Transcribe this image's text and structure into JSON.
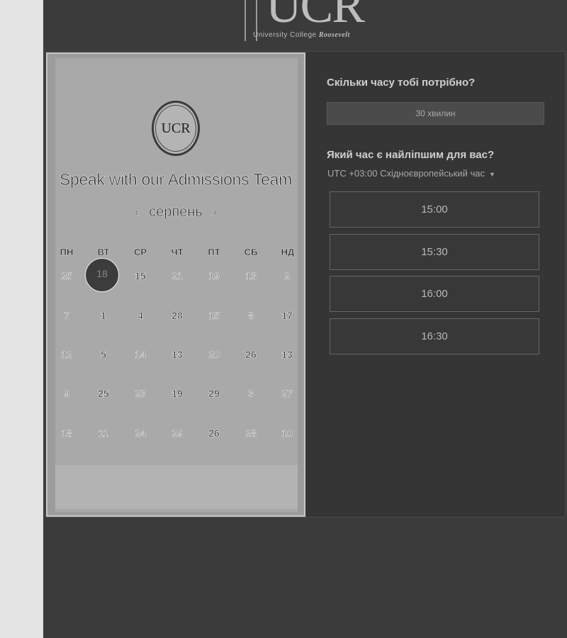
{
  "header": {
    "logo_big": "UCR",
    "logo_sub_normal": "University College ",
    "logo_sub_bold": "Roosevelt"
  },
  "calendar": {
    "emblem_text": "UCR",
    "title": "Speak with our Admissions Team",
    "month": "серпень",
    "prev_icon": "‹",
    "next_icon": "›",
    "weekdays": [
      "ПН",
      "ВТ",
      "СР",
      "ЧТ",
      "ПТ",
      "СБ",
      "НД"
    ],
    "selected_day": "18",
    "weeks": [
      [
        "25",
        "",
        "15",
        "21",
        "19",
        "13",
        "2"
      ],
      [
        "7",
        "1",
        "4",
        "28",
        "15",
        "8",
        "17"
      ],
      [
        "12",
        "5",
        "14",
        "13",
        "20",
        "26",
        "13"
      ],
      [
        "9",
        "25",
        "23",
        "19",
        "29",
        "3",
        "27"
      ],
      [
        "18",
        "11",
        "24",
        "29",
        "26",
        "28",
        "10"
      ]
    ]
  },
  "booking": {
    "duration_question": "Скільки часу тобі потрібно?",
    "duration_value": "30 хвилин",
    "time_question": "Який час є найліпшим для вас?",
    "timezone": "UTC +03:00 Східноєвропейський час",
    "slots": [
      "15:00",
      "15:30",
      "16:00",
      "16:30"
    ]
  }
}
